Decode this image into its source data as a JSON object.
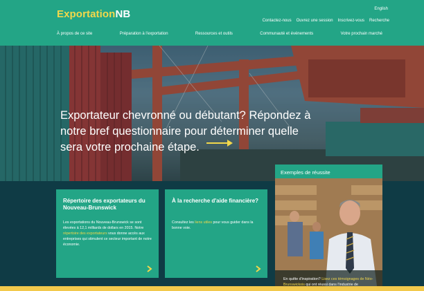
{
  "header": {
    "logo_main": "Exportation",
    "logo_suffix": "NB",
    "language_link": "English",
    "utility_links": [
      "Contactez-nous",
      "Ouvrez une session",
      "Inscrivez-vous",
      "Recherche"
    ],
    "main_nav": [
      "À propos de ce site",
      "Préparation à l'exportation",
      "Ressources et outils",
      "Communauté et événements",
      "Votre prochain marché"
    ]
  },
  "hero": {
    "text": "Exportateur chevronné ou débutant? Répondez à notre bref questionnaire pour déterminer quelle sera votre prochaine étape."
  },
  "cards": {
    "directory": {
      "title": "Répertoire des exportateurs du Nouveau-Brunswick",
      "body_before": "Les exportations du Nouveau-Brunswick se sont élevées à 12,1 milliards de dollars en 2015. Notre ",
      "link": "répertoire des exportateurs",
      "body_after": " vous donne accès aux entreprises qui stimulent ce secteur important de notre économie."
    },
    "funding": {
      "title": "À la recherche d'aide financière?",
      "body_before": "Consultez les ",
      "link": "liens utiles",
      "body_after": " pour vous guider dans la bonne voie."
    }
  },
  "success": {
    "title": "Exemples de réussite",
    "caption_before": "En quête d'inspiration? ",
    "caption_link": "Lisez ces témoignages de Néo-Brunswickois",
    "caption_after": " qui ont réussi dans l'industrie de l'exportation."
  },
  "colors": {
    "brand_green": "#23a586",
    "accent_yellow": "#f2d84b",
    "dark_navy": "#0f3b45"
  },
  "icons": {
    "hero_arrow": "right-arrow-icon",
    "card_chevron": "chevron-right-icon"
  }
}
